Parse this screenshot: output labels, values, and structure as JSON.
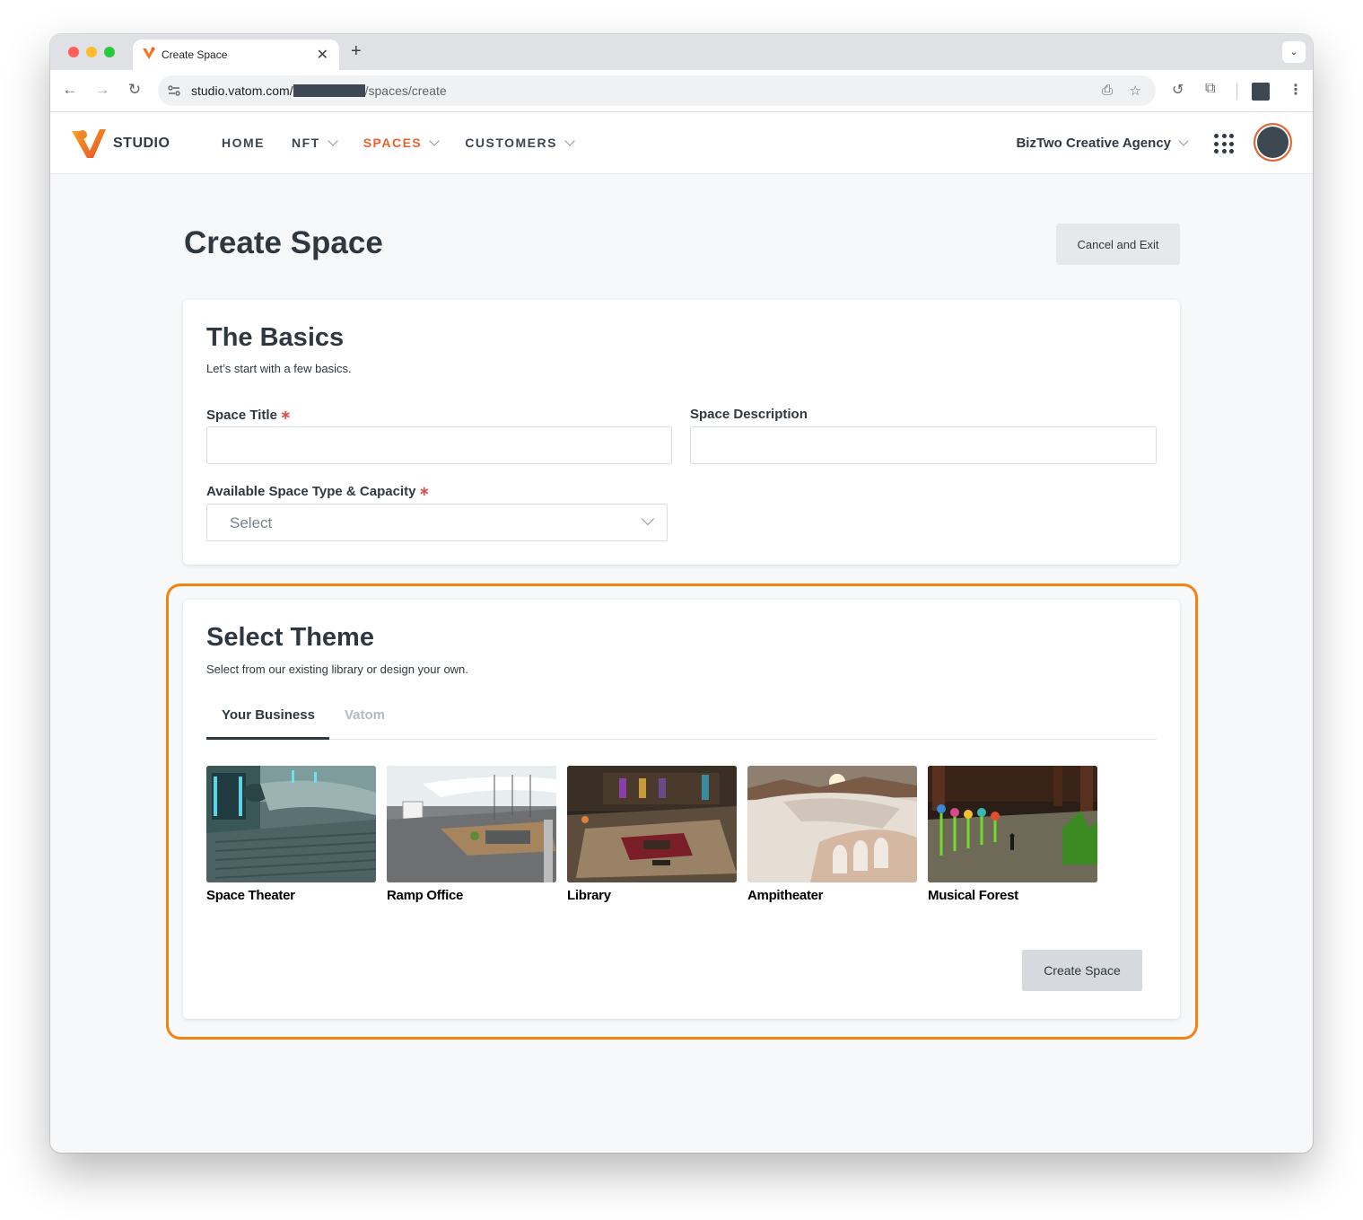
{
  "browser": {
    "tab_title": "Create Space",
    "new_tab_symbol": "+",
    "close_symbol": "✕",
    "url_prefix": "studio.vatom.com/",
    "url_path": "/spaces/create"
  },
  "app": {
    "brand": "STUDIO",
    "accent_color": "#e8622c",
    "nav": [
      {
        "label": "HOME"
      },
      {
        "label": "NFT"
      },
      {
        "label": "SPACES"
      },
      {
        "label": "CUSTOMERS"
      }
    ],
    "org_name": "BizTwo Creative Agency"
  },
  "page": {
    "title": "Create Space",
    "cancel_label": "Cancel and Exit"
  },
  "basics": {
    "heading": "The Basics",
    "subtitle": "Let’s start with a few basics.",
    "space_title_label": "Space Title",
    "space_title_value": "",
    "space_description_label": "Space Description",
    "space_description_value": "",
    "space_type_label": "Available Space Type & Capacity",
    "space_type_value": "Select",
    "required_mark": "∗"
  },
  "theme": {
    "heading": "Select Theme",
    "subtitle": "Select from our existing library or design your own.",
    "highlight_color": "#f5820d",
    "tabs": [
      {
        "label": "Your Business"
      },
      {
        "label": "Vatom"
      }
    ],
    "items": [
      {
        "label": "Space Theater"
      },
      {
        "label": "Ramp Office"
      },
      {
        "label": "Library"
      },
      {
        "label": "Ampitheater"
      },
      {
        "label": "Musical Forest"
      }
    ],
    "create_label": "Create Space"
  }
}
